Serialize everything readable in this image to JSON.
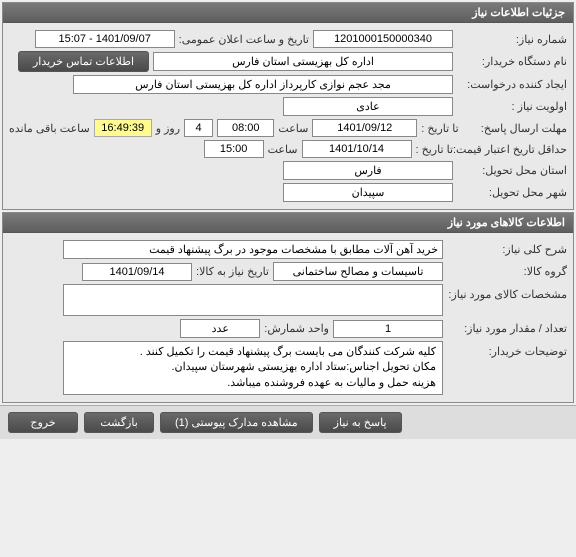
{
  "panel1": {
    "title": "جزئیات اطلاعات نیاز",
    "need_number_label": "شماره نیاز:",
    "need_number": "1201000150000340",
    "announce_label": "تاریخ و ساعت اعلان عمومی:",
    "announce_value": "1401/09/07 - 15:07",
    "buyer_org_label": "نام دستگاه خریدار:",
    "buyer_org": "اداره کل بهزیستی استان فارس",
    "contact_btn": "اطلاعات تماس خریدار",
    "creator_label": "ایجاد کننده درخواست:",
    "creator": "مجد عجم نوازی کارپرداز اداره کل بهزیستی استان فارس",
    "priority_label": "اولویت نیاز :",
    "priority": "عادی",
    "reply_deadline_label": "مهلت ارسال پاسخ:",
    "until_label": "تا تاریخ :",
    "reply_date": "1401/09/12",
    "time_label": "ساعت",
    "reply_time": "08:00",
    "days": "4",
    "days_label": "روز و",
    "remain_time": "16:49:39",
    "remain_label": "ساعت باقی مانده",
    "validity_label": "حداقل تاریخ اعتبار قیمت:",
    "validity_date": "1401/10/14",
    "validity_time": "15:00",
    "delivery_province_label": "استان محل تحویل:",
    "delivery_province": "فارس",
    "delivery_city_label": "شهر محل تحویل:",
    "delivery_city": "سپیدان"
  },
  "panel2": {
    "title": "اطلاعات کالاهای مورد نیاز",
    "need_desc_label": "شرح کلی نیاز:",
    "need_desc": "خرید آهن آلات مطابق با مشخصات موجود در برگ پیشنهاد قیمت",
    "group_label": "گروه کالا:",
    "group": "تاسیسات و مصالح ساختمانی",
    "need_by_date_label": "تاریخ نیاز به کالا:",
    "need_by_date": "1401/09/14",
    "specs_label": "مشخصات کالای مورد نیاز:",
    "specs": "",
    "qty_label": "تعداد / مقدار مورد نیاز:",
    "qty": "1",
    "unit_label": "واحد شمارش:",
    "unit": "عدد",
    "buyer_notes_label": "توضیحات خریدار:",
    "buyer_notes": "کلیه شرکت کنندگان می بایست برگ پیشنهاد قیمت را تکمیل کنند .\nمکان تحویل اجناس:ستاد اداره بهزیستی شهرستان سپیدان.\nهزینه حمل و مالیات  به عهده فروشنده میباشد."
  },
  "footer": {
    "reply": "پاسخ به نیاز",
    "attachments": "مشاهده مدارک پیوستی (1)",
    "back": "بازگشت",
    "exit": "خروج"
  }
}
